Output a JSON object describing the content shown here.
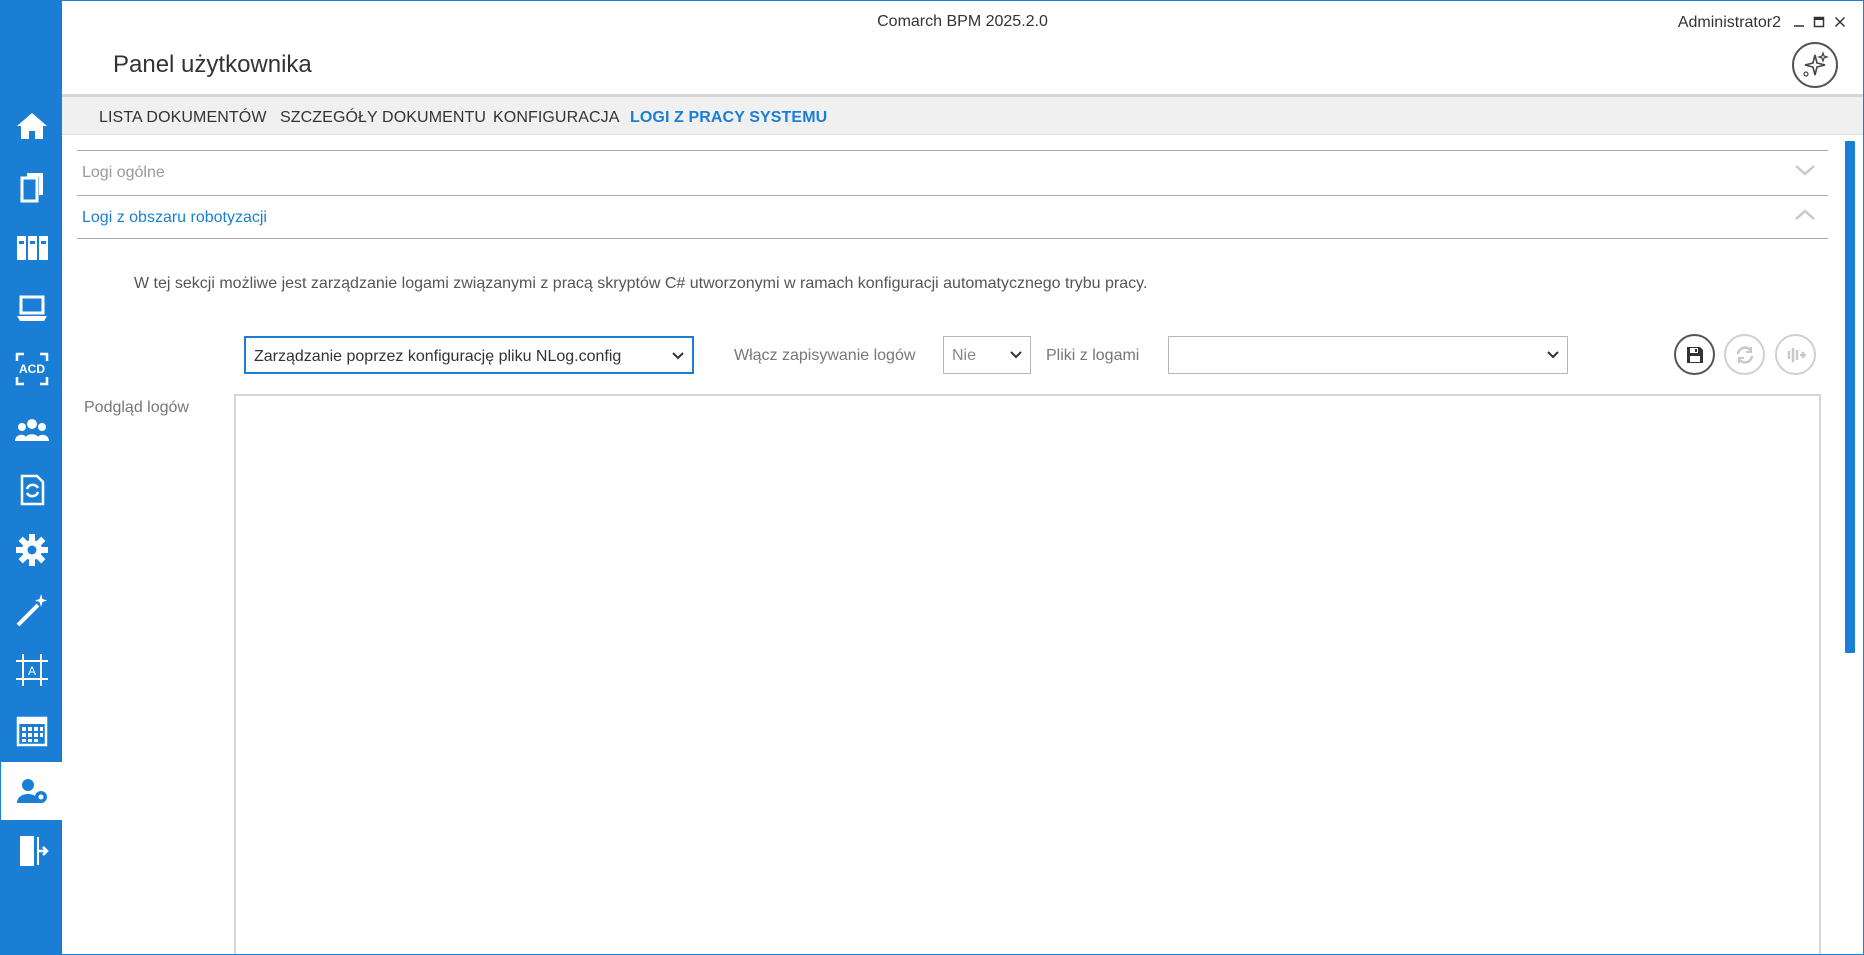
{
  "window": {
    "app_title": "Comarch BPM 2025.2.0",
    "user": "Administrator2"
  },
  "page": {
    "title": "Panel użytkownika"
  },
  "tabs": [
    {
      "label": "LISTA DOKUMENTÓW",
      "active": false
    },
    {
      "label": "SZCZEGÓŁY DOKUMENTU",
      "active": false
    },
    {
      "label": "KONFIGURACJA",
      "active": false
    },
    {
      "label": "LOGI Z PRACY SYSTEMU",
      "active": true
    }
  ],
  "sidebar": {
    "items": [
      {
        "icon": "home-icon"
      },
      {
        "icon": "documents-icon"
      },
      {
        "icon": "binders-icon"
      },
      {
        "icon": "laptop-icon"
      },
      {
        "icon": "acd-icon",
        "text": "ACD"
      },
      {
        "icon": "users-group-icon"
      },
      {
        "icon": "document-sync-icon"
      },
      {
        "icon": "gear-icon"
      },
      {
        "icon": "magic-wand-icon"
      },
      {
        "icon": "designer-frame-icon",
        "text": "A"
      },
      {
        "icon": "calendar-icon"
      },
      {
        "icon": "user-settings-icon",
        "active": true
      },
      {
        "icon": "logout-door-icon"
      }
    ]
  },
  "accordion": {
    "general": {
      "label": "Logi ogólne",
      "expanded": false
    },
    "robotization": {
      "label": "Logi z obszaru robotyzacji",
      "expanded": true
    }
  },
  "section": {
    "description": "W tej sekcji możliwe jest zarządzanie logami związanymi z pracą skryptów C# utworzonymi w ramach konfiguracji automatycznego trybu pracy."
  },
  "controls": {
    "mode_select": {
      "value": "Zarządzanie poprzez konfigurację pliku NLog.config"
    },
    "enable_logging_label": "Włącz zapisywanie logów",
    "enable_logging_value": "Nie",
    "log_files_label": "Pliki z logami",
    "log_files_value": "",
    "preview_label": "Podgląd logów",
    "preview_content": ""
  },
  "colors": {
    "accent": "#1a7fd4",
    "sidebar_bg": "#1a7fd4",
    "tab_bar_bg": "#f0f0f0"
  }
}
